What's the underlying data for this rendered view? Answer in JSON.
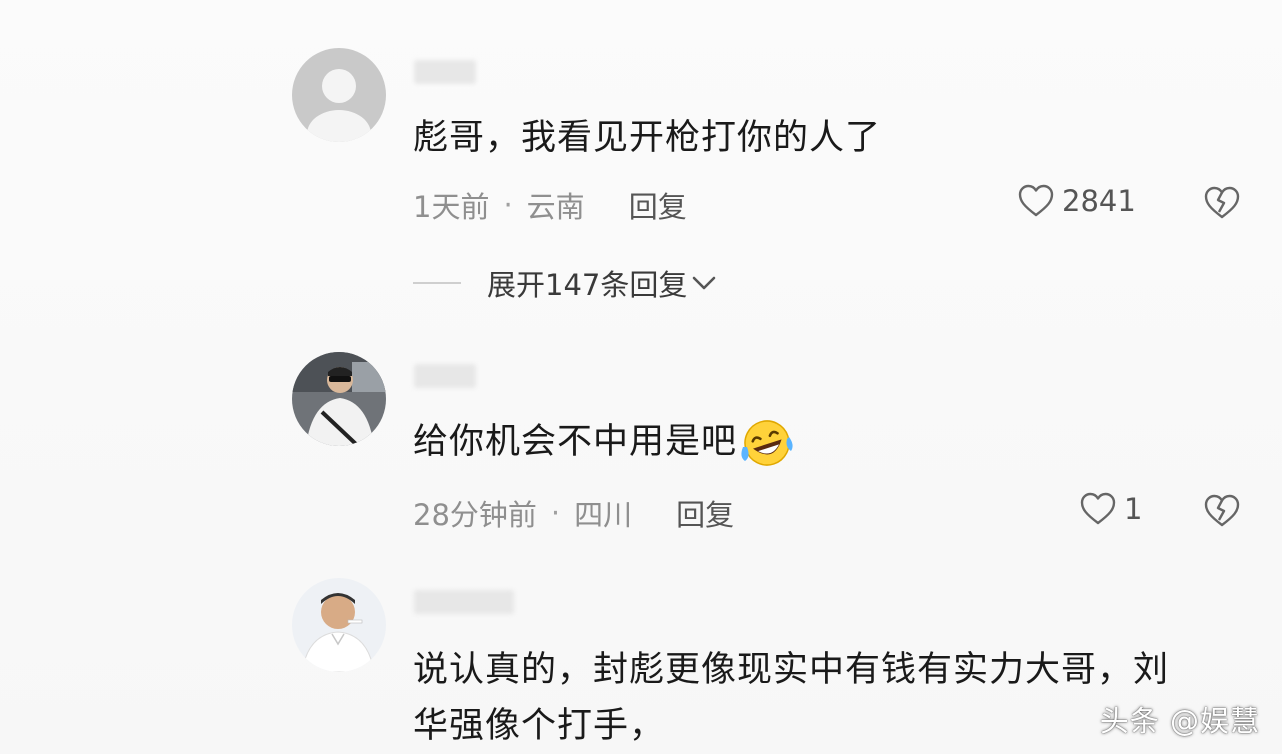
{
  "comments": [
    {
      "text": "彪哥，我看见开枪打你的人了",
      "time": "1天前",
      "location": "云南",
      "reply_label": "回复",
      "likes": "2841",
      "expand_label": "展开147条回复"
    },
    {
      "text": "给你机会不中用是吧",
      "emoji": "laughing-crying-emoji",
      "time": "28分钟前",
      "location": "四川",
      "reply_label": "回复",
      "likes": "1"
    },
    {
      "text_line1": "说认真的，封彪更像现实中有钱有实力大哥，刘",
      "text_line2": "华强像个打手，"
    }
  ],
  "separator": "·",
  "watermark": "头条 @娱慧",
  "icons": {
    "like": "heart-outline-icon",
    "dislike": "broken-heart-icon",
    "expand": "chevron-down-icon"
  },
  "colors": {
    "text": "#1a1a1a",
    "meta": "#8f8f8f",
    "icon": "#666666"
  }
}
